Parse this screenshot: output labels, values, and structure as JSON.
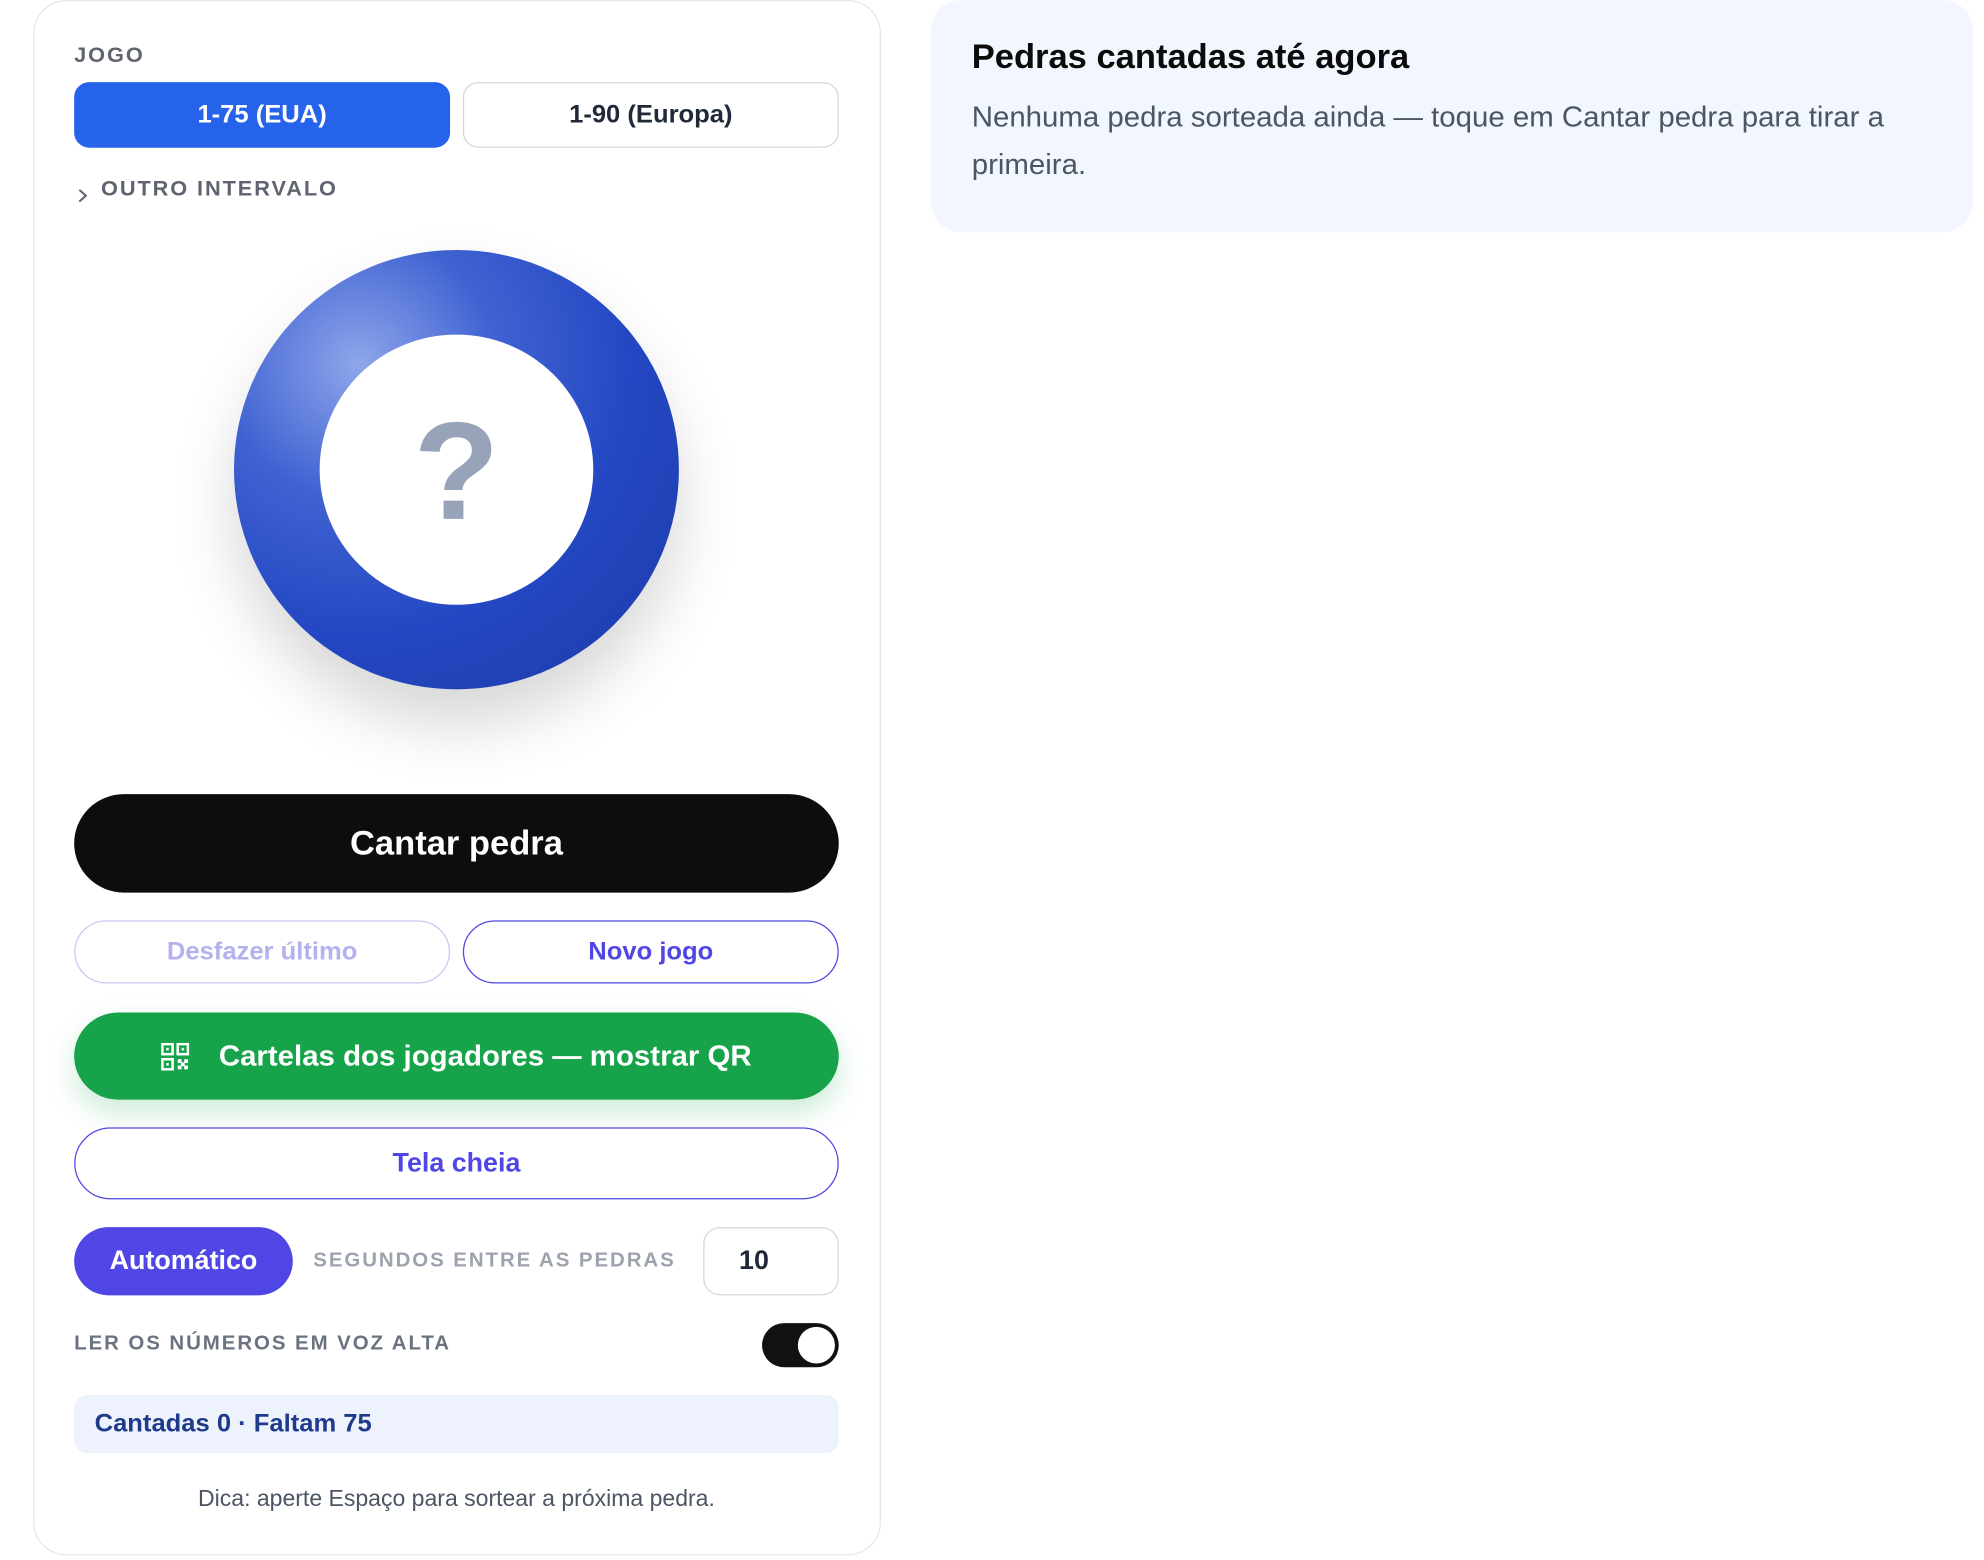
{
  "game": {
    "section_label": "JOGO",
    "range_options": [
      "1-75 (EUA)",
      "1-90 (Europa)"
    ],
    "selected_range": "1-75 (EUA)",
    "other_range_label": "OUTRO INTERVALO"
  },
  "ball": {
    "display": "?"
  },
  "actions": {
    "call_label": "Cantar pedra",
    "undo_label": "Desfazer último",
    "new_game_label": "Novo jogo",
    "qr_label": "Cartelas dos jogadores — mostrar QR",
    "fullscreen_label": "Tela cheia"
  },
  "auto": {
    "button_label": "Automático",
    "seconds_label": "SEGUNDOS ENTRE AS PEDRAS",
    "seconds_value": "10"
  },
  "voice": {
    "label": "LER OS NÚMEROS EM VOZ ALTA",
    "enabled": true
  },
  "status": {
    "text": "Cantadas 0 · Faltam 75"
  },
  "tip": "Dica: aperte Espaço para sortear a próxima pedra.",
  "history": {
    "title": "Pedras cantadas até agora",
    "empty_text": "Nenhuma pedra sorteada ainda — toque em Cantar pedra para tirar a primeira."
  },
  "icons": {
    "disclosure": "chevron-right-icon",
    "qr": "qr-code-icon"
  },
  "colors": {
    "primary_blue": "#2563eb",
    "indigo": "#4f46e5",
    "green": "#16a34a",
    "black": "#0d0d0d"
  }
}
